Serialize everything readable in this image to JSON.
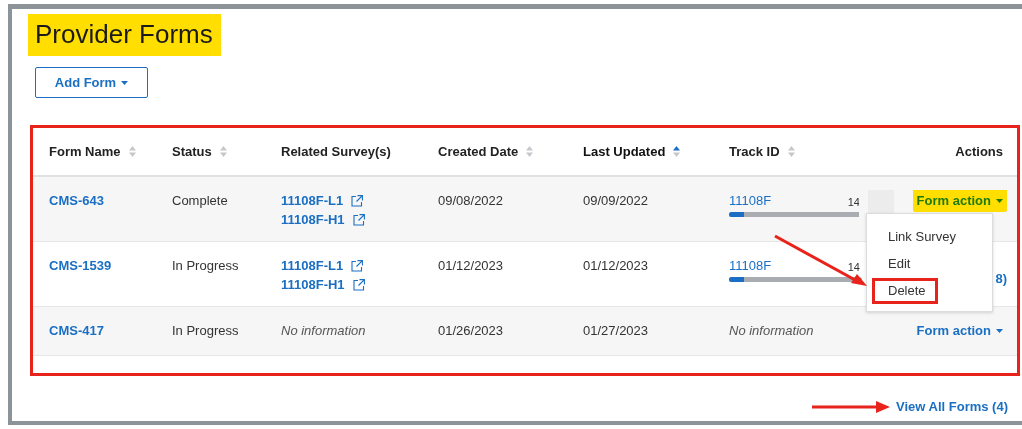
{
  "title": {
    "text": "Provider Forms",
    "highlighted": true
  },
  "add_button": {
    "label": "Add Form"
  },
  "table": {
    "outlined": true,
    "columns": [
      {
        "label": "Form Name",
        "sortable": true,
        "sorted": false
      },
      {
        "label": "Status",
        "sortable": true,
        "sorted": false
      },
      {
        "label": "Related Survey(s)",
        "sortable": false,
        "sorted": false
      },
      {
        "label": "Created Date",
        "sortable": true,
        "sorted": false
      },
      {
        "label": "Last Updated",
        "sortable": true,
        "sorted": true
      },
      {
        "label": "Track ID",
        "sortable": true,
        "sorted": false
      },
      {
        "label": "Actions",
        "sortable": false,
        "sorted": false
      }
    ],
    "rows": [
      {
        "form_name": "CMS-643",
        "status": "Complete",
        "surveys": [
          "11108F-L1",
          "11108F-H1"
        ],
        "created": "09/08/2022",
        "updated": "09/09/2022",
        "track": {
          "id": "11108F",
          "count": "14",
          "level": 0.11
        },
        "redacted": true,
        "action": {
          "label": "Form action",
          "highlighted": true,
          "expanded": true
        }
      },
      {
        "form_name": "CMS-1539",
        "status": "In Progress",
        "surveys": [
          "11108F-L1",
          "11108F-H1"
        ],
        "created": "01/12/2023",
        "updated": "01/12/2023",
        "track": {
          "id": "11108F",
          "count": "14",
          "level": 0.11
        },
        "action_fragment": "8)"
      },
      {
        "form_name": "CMS-417",
        "status": "In Progress",
        "surveys_placeholder": "No information",
        "created": "01/26/2023",
        "updated": "01/27/2023",
        "track_placeholder": "No information",
        "action": {
          "label": "Form action",
          "highlighted": false
        }
      }
    ]
  },
  "menu": {
    "items": [
      {
        "label": "Link Survey",
        "outlined": false
      },
      {
        "label": "Edit",
        "outlined": false
      },
      {
        "label": "Delete",
        "outlined": true
      }
    ],
    "pointer_arrow": true
  },
  "view_all": {
    "label": "View All Forms (4)",
    "pointer_arrow": true
  }
}
